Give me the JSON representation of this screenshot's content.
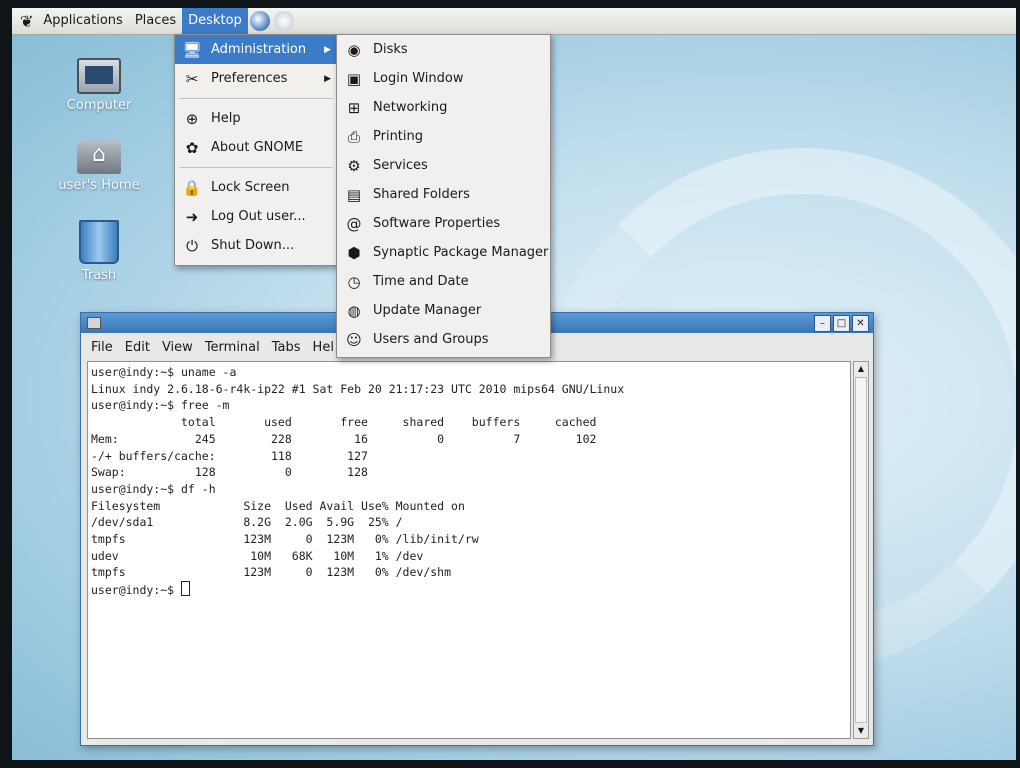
{
  "panel": {
    "menus": [
      "Applications",
      "Places",
      "Desktop"
    ],
    "active_menu": "Desktop",
    "launchers": [
      "web-browser-icon",
      "mail-icon"
    ]
  },
  "desktop_icons": [
    {
      "label": "Computer",
      "icon": "computer-icon"
    },
    {
      "label": "user's Home",
      "icon": "home-folder-icon"
    },
    {
      "label": "Trash",
      "icon": "trash-icon"
    }
  ],
  "desktop_menu": {
    "items": [
      {
        "label": "Administration",
        "icon": "administration-icon",
        "submenu": true,
        "highlighted": true
      },
      {
        "label": "Preferences",
        "icon": "preferences-icon",
        "submenu": true
      },
      {
        "label": "Help",
        "icon": "help-icon"
      },
      {
        "label": "About GNOME",
        "icon": "gnome-icon"
      },
      {
        "label": "Lock Screen",
        "icon": "lock-icon"
      },
      {
        "label": "Log Out user...",
        "icon": "logout-icon"
      },
      {
        "label": "Shut Down...",
        "icon": "shutdown-icon"
      }
    ]
  },
  "admin_menu": {
    "items": [
      {
        "label": "Disks",
        "icon": "disks-icon"
      },
      {
        "label": "Login Window",
        "icon": "login-window-icon"
      },
      {
        "label": "Networking",
        "icon": "networking-icon"
      },
      {
        "label": "Printing",
        "icon": "printer-icon"
      },
      {
        "label": "Services",
        "icon": "services-icon"
      },
      {
        "label": "Shared Folders",
        "icon": "shared-folders-icon"
      },
      {
        "label": "Software Properties",
        "icon": "software-properties-icon"
      },
      {
        "label": "Synaptic Package Manager",
        "icon": "synaptic-icon"
      },
      {
        "label": "Time and Date",
        "icon": "clock-icon"
      },
      {
        "label": "Update Manager",
        "icon": "update-icon"
      },
      {
        "label": "Users and Groups",
        "icon": "users-icon"
      }
    ]
  },
  "terminal": {
    "menu": [
      "File",
      "Edit",
      "View",
      "Terminal",
      "Tabs",
      "Hel"
    ],
    "lines": [
      "user@indy:~$ uname -a",
      "Linux indy 2.6.18-6-r4k-ip22 #1 Sat Feb 20 21:17:23 UTC 2010 mips64 GNU/Linux",
      "user@indy:~$ free -m",
      "             total       used       free     shared    buffers     cached",
      "Mem:           245        228         16          0          7        102",
      "-/+ buffers/cache:        118        127",
      "Swap:          128          0        128",
      "user@indy:~$ df -h",
      "Filesystem            Size  Used Avail Use% Mounted on",
      "/dev/sda1             8.2G  2.0G  5.9G  25% /",
      "tmpfs                 123M     0  123M   0% /lib/init/rw",
      "udev                   10M   68K   10M   1% /dev",
      "tmpfs                 123M     0  123M   0% /dev/shm"
    ],
    "prompt": "user@indy:~$ "
  },
  "colors": {
    "highlight": "#3b7bc8",
    "titlebar": "#4a88c8",
    "desktop": "#a8d0e6"
  }
}
